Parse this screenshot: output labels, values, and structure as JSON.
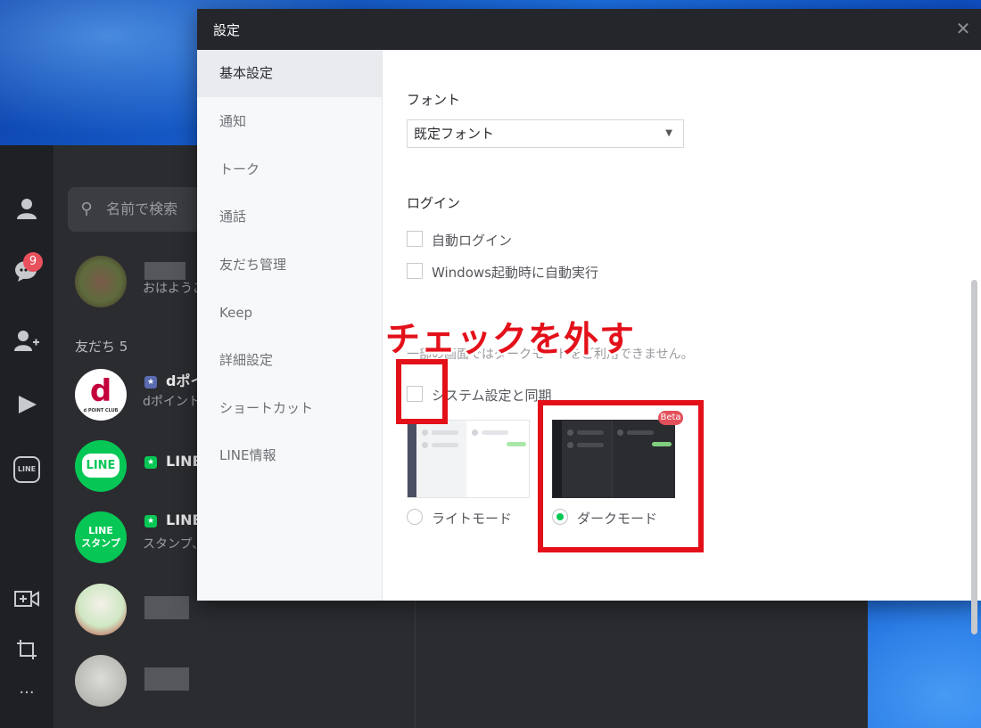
{
  "colors": {
    "accent_green": "#06c755",
    "annotation_red": "#e3101a",
    "badge_red": "#e8505b",
    "dark_bg": "#2b2c30"
  },
  "settings": {
    "title": "設定",
    "close_icon": "close-icon",
    "nav": [
      "基本設定",
      "通知",
      "トーク",
      "通話",
      "友だち管理",
      "Keep",
      "詳細設定",
      "ショートカット",
      "LINE情報"
    ],
    "active_nav": "基本設定",
    "font": {
      "title": "フォント",
      "value": "既定フォント"
    },
    "login": {
      "title": "ログイン",
      "auto_login": "自動ログイン",
      "auto_start": "Windows起動時に自動実行"
    },
    "theme": {
      "hint": "一部の画面ではダークモードをご利用できません。",
      "sync_label": "システム設定と同期",
      "light_label": "ライトモード",
      "dark_label": "ダークモード",
      "beta_label": "Beta",
      "selected": "dark"
    }
  },
  "annotation": {
    "text": "チェックを外す"
  },
  "line_app": {
    "search_placeholder": "名前で検索",
    "unread_badge": "9",
    "friends_section": "友だち 5",
    "rows": [
      {
        "avatar_label": "",
        "name": "",
        "message": "おはようご"
      },
      {
        "avatar_label": "d",
        "name": "dポイ",
        "message": "dポイント"
      },
      {
        "avatar_label": "LINE",
        "name": "LINE",
        "message": ""
      },
      {
        "avatar_label": "LINE\nスタンプ",
        "name": "LINE",
        "message": "スタンプ、"
      },
      {
        "avatar_label": "",
        "name": "",
        "message": ""
      },
      {
        "avatar_label": "",
        "name": "",
        "message": ""
      }
    ],
    "rail_icons": [
      "person-icon",
      "chat-icon",
      "add-friend-icon",
      "play-icon",
      "line-icon",
      "video-call-icon",
      "crop-icon",
      "more-icon"
    ],
    "line_icon_label": "LINE",
    "more_label": "···",
    "dpoint_club": "d POINT CLUB"
  }
}
